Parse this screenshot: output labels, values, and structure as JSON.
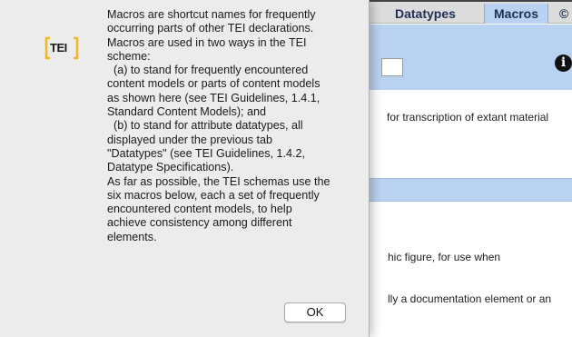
{
  "tabs": {
    "datatypes_label": "Datatypes",
    "macros_label": "Macros",
    "more_label": "©"
  },
  "info_icon": {
    "glyph": "i"
  },
  "background": {
    "description": "for transcription of extant material",
    "row1_text": "hic figure, for use when",
    "row2_text": "lly a documentation element or an"
  },
  "dialog": {
    "logo_text": "TEI",
    "message_lines": [
      "Macros are shortcut names for frequently",
      "occurring parts of other TEI declarations.",
      "Macros are used in two ways in the TEI",
      "scheme:",
      "  (a) to stand for frequently encountered",
      "content models or parts of content models",
      "as shown here (see TEI Guidelines, 1.4.1,",
      "Standard Content Models); and",
      "  (b) to stand for attribute datatypes, all",
      "displayed under the previous tab",
      "\"Datatypes\" (see TEI Guidelines, 1.4.2,",
      "Datatype Specifications).",
      "As far as possible, the TEI schemas use the",
      "six macros below, each a set of frequently",
      "encountered content models, to help",
      "achieve consistency among different",
      "elements."
    ],
    "ok_label": "OK"
  },
  "colors": {
    "accent_blue": "#b9d2f1",
    "logo_yellow": "#f2b824",
    "dialog_bg": "#ececec"
  }
}
